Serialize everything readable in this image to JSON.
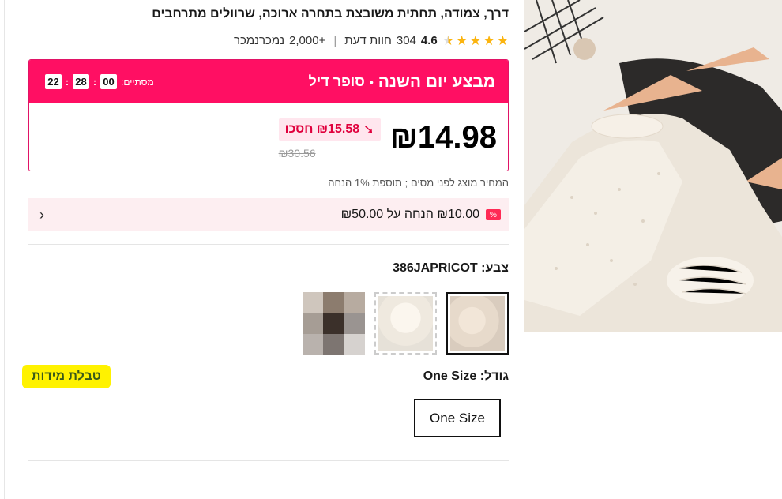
{
  "product": {
    "title": "דרך, צמודה, תחתית משובצת בתחרה ארוכה, שרוולים מתרחבים",
    "rating": "4.6",
    "reviews_count": "304",
    "reviews_label": "חוות דעת",
    "sold": "+2,000",
    "sold_label": "נמכרנמכר"
  },
  "deal": {
    "title": "מבצע יום השנה",
    "subtitle": "סופר דיל",
    "ends_label": "מסתיים:",
    "hours": "00",
    "minutes": "28",
    "seconds": "22",
    "price": "₪14.98",
    "save": "₪15.58 חסכו",
    "old_price": "₪30.56"
  },
  "tax_note": "המחיר מוצג לפני מסים ; תוספת 1% הנחה",
  "coupon": {
    "text": "₪10.00 הנחה על ₪50.00",
    "icon": "%"
  },
  "color": {
    "label": "צבע:",
    "value": "386JAPRICOT"
  },
  "size": {
    "label": "גודל:",
    "value": "One Size",
    "chart_link": "טבלת מידות",
    "option": "One Size"
  },
  "colors": {
    "accent": "#ff0f63",
    "star": "#fbb40f",
    "highlight": "#fff200"
  }
}
